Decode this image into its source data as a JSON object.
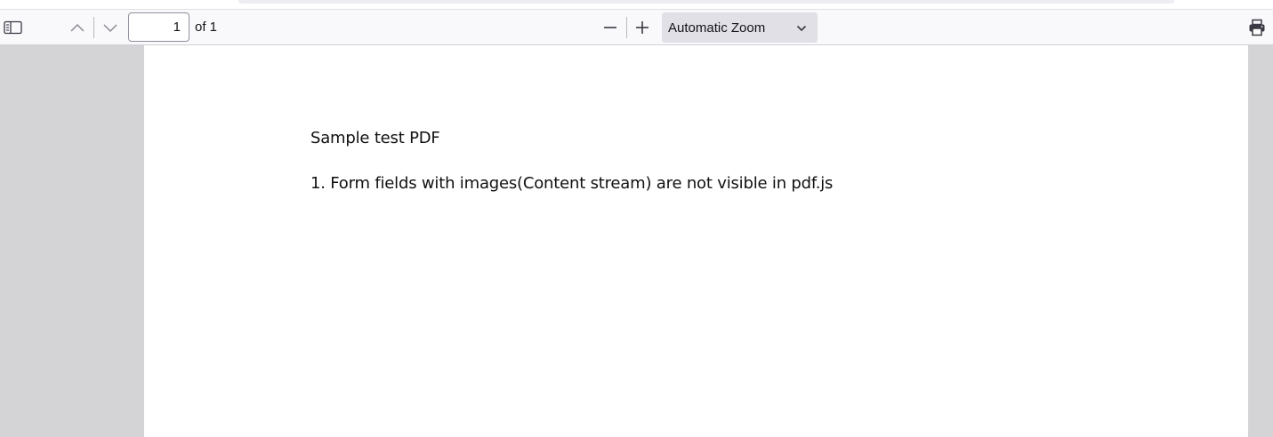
{
  "toolbar": {
    "sidebar_icon": "sidebar-toggle-icon",
    "prev_icon": "chevron-up-icon",
    "next_icon": "chevron-down-icon",
    "page_number": "1",
    "page_count_label": "of 1",
    "zoom_out_icon": "minus-icon",
    "zoom_in_icon": "plus-icon",
    "zoom_value": "Automatic Zoom",
    "print_icon": "printer-icon"
  },
  "document": {
    "lines": [
      "Sample test PDF",
      "1. Form fields with images(Content stream) are not visible in pdf.js"
    ]
  },
  "colors": {
    "toolbar_bg": "#f9f9fb",
    "viewer_bg": "#d4d4d7",
    "zoom_bg": "#e0e0e6",
    "page_bg": "#ffffff"
  }
}
